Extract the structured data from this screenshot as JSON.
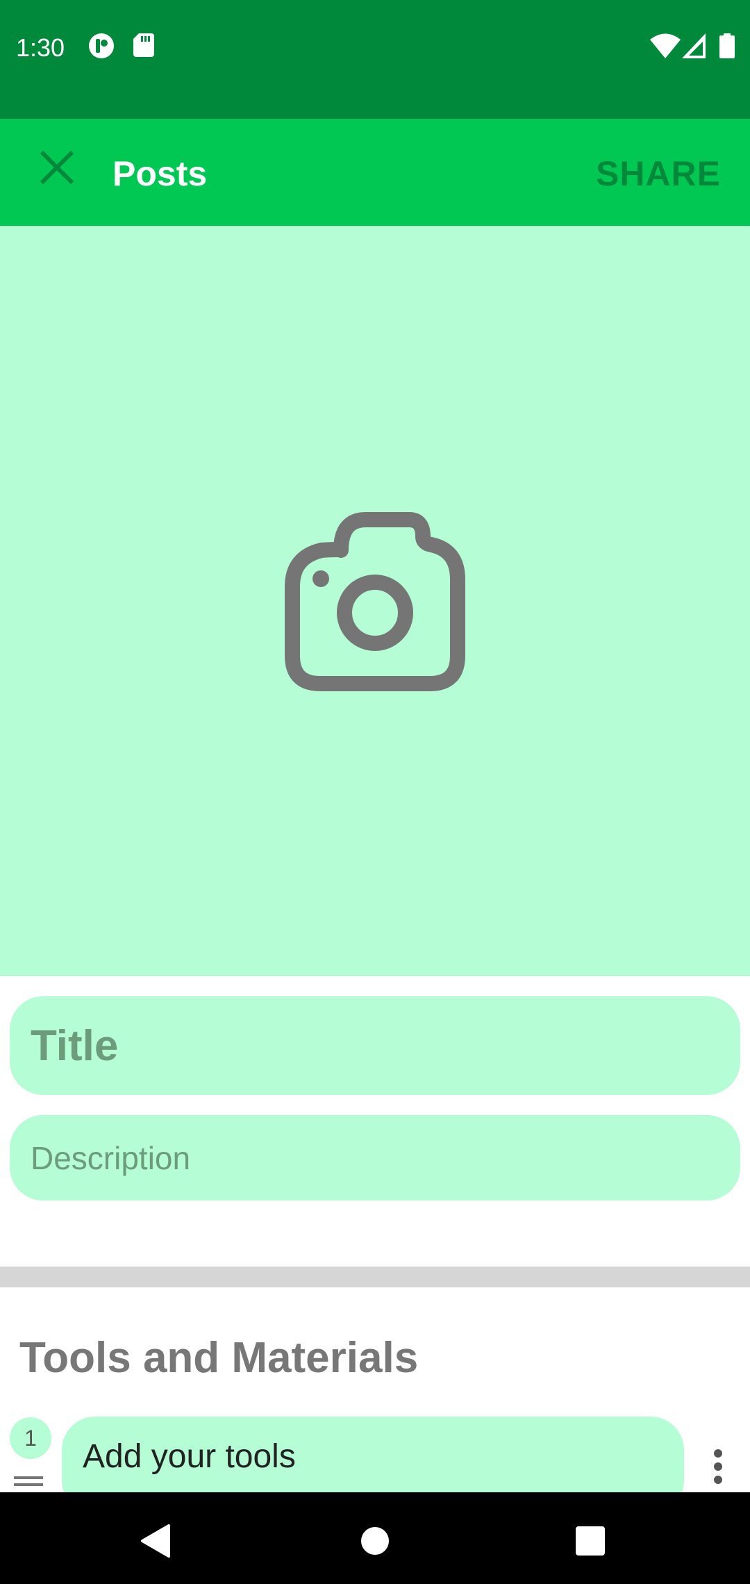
{
  "status_bar": {
    "time": "1:30",
    "left_icons": [
      "notification-app-icon",
      "sd-card-icon"
    ],
    "right_icons": [
      "wifi-icon",
      "signal-icon",
      "battery-icon"
    ]
  },
  "app_bar": {
    "close_icon": "close-icon",
    "title": "Posts",
    "share_label": "SHARE"
  },
  "photo_area": {
    "icon": "camera-icon"
  },
  "form": {
    "title_placeholder": "Title",
    "description_placeholder": "Description"
  },
  "tools_section": {
    "heading": "Tools and Materials",
    "items": [
      {
        "number": "1",
        "placeholder": "Add your tools"
      }
    ]
  },
  "nav_bar": {
    "buttons": [
      "back-icon",
      "home-icon",
      "recents-icon"
    ]
  },
  "colors": {
    "status_bar": "#00893a",
    "app_bar": "#00c853",
    "light_green": "#b4fdd5",
    "icon_gray": "#757575"
  }
}
